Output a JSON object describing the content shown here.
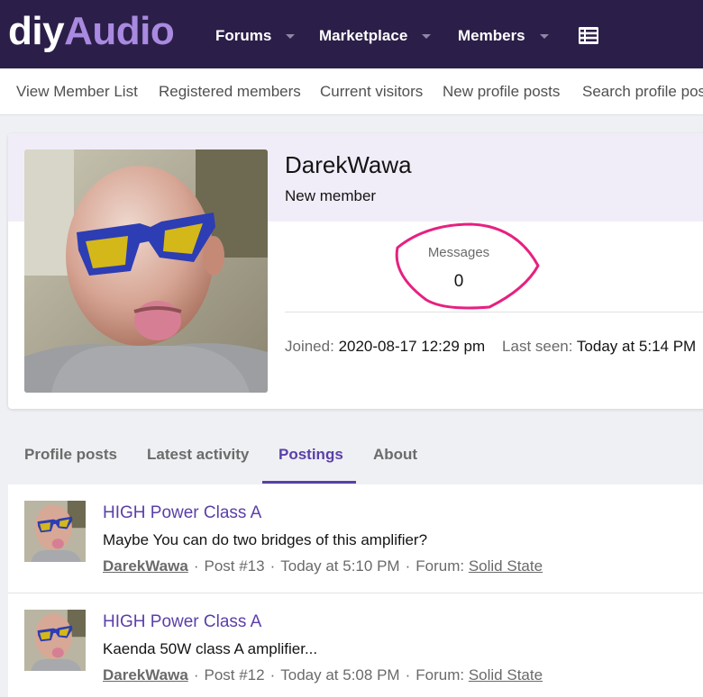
{
  "header": {
    "logo_part1": "diy",
    "logo_part2": "Audio",
    "nav": [
      {
        "label": "Forums"
      },
      {
        "label": "Marketplace"
      },
      {
        "label": "Members"
      }
    ],
    "menu_icon": "list-icon"
  },
  "subnav": {
    "items": [
      {
        "label": "View Member List"
      },
      {
        "label": "Registered members"
      },
      {
        "label": "Current visitors"
      },
      {
        "label": "New profile posts"
      },
      {
        "label": "Search profile pos"
      }
    ]
  },
  "profile": {
    "username": "DarekWawa",
    "user_title": "New member",
    "messages_label": "Messages",
    "messages_value": "0",
    "joined_label": "Joined:",
    "joined_value": "2020-08-17 12:29 pm",
    "last_seen_label": "Last seen:",
    "last_seen_value": "Today at 5:14 PM"
  },
  "tabs": [
    {
      "label": "Profile posts"
    },
    {
      "label": "Latest activity"
    },
    {
      "label": "Postings",
      "active": true
    },
    {
      "label": "About"
    }
  ],
  "posts": [
    {
      "title": "HIGH Power Class A",
      "snippet": "Maybe You can do two bridges of this amplifier?",
      "author": "DarekWawa",
      "post_number": "Post #13",
      "time": "Today at 5:10 PM",
      "forum_label": "Forum:",
      "forum": "Solid State"
    },
    {
      "title": "HIGH Power Class A",
      "snippet": "Kaenda 50W class A amplifier...",
      "author": "DarekWawa",
      "post_number": "Post #12",
      "time": "Today at 5:08 PM",
      "forum_label": "Forum:",
      "forum": "Solid State"
    }
  ],
  "colors": {
    "header_bg": "#2b1f49",
    "accent": "#5b3fa8",
    "logo_accent": "#a98ae0",
    "annotation": "#e6217f"
  }
}
